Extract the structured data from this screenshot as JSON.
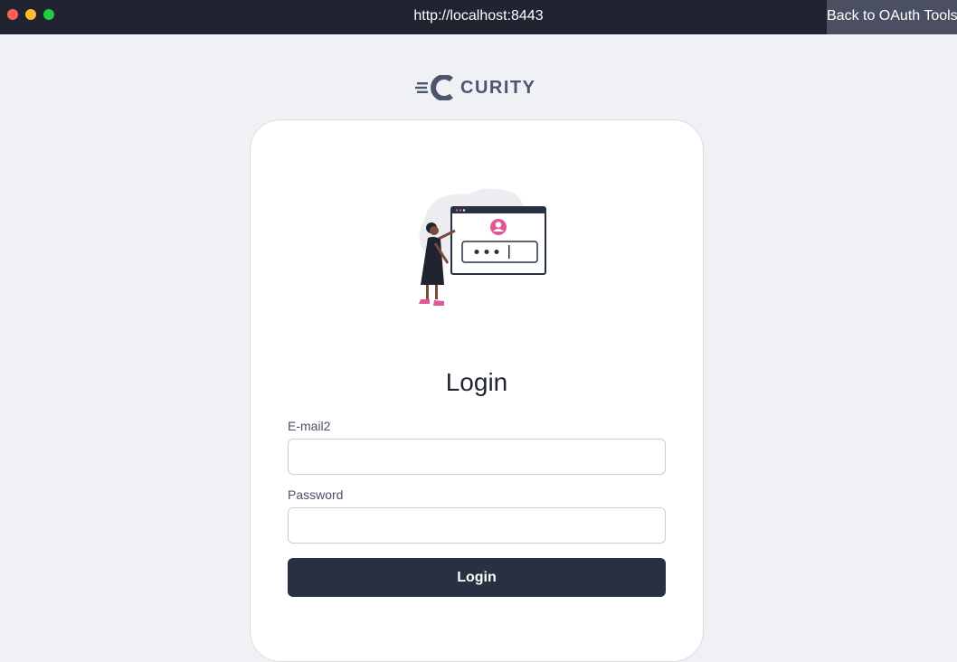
{
  "window": {
    "url": "http://localhost:8443",
    "back_button_label": "Back to OAuth Tools"
  },
  "brand": {
    "logo_text": "CURITY"
  },
  "login_form": {
    "heading": "Login",
    "email_label": "E-mail2",
    "email_value": "",
    "password_label": "Password",
    "password_value": "",
    "submit_label": "Login"
  },
  "illustration": {
    "icon": "person-at-login-screen-illustration"
  },
  "colors": {
    "titlebar": "#1f2430",
    "page_background": "#f0f1f4",
    "button_background": "#283142",
    "accent_pink": "#e0589a"
  }
}
